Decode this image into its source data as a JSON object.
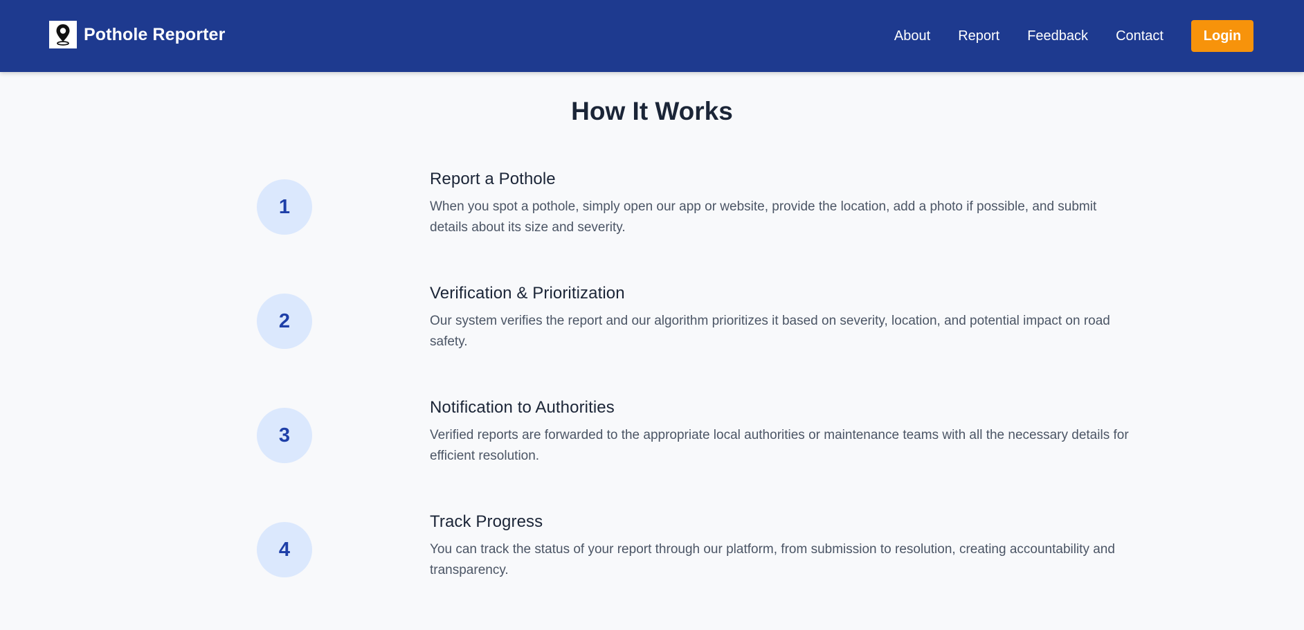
{
  "navbar": {
    "brand": "Pothole Reporter",
    "logo_icon": "map-pin-icon",
    "links": [
      "About",
      "Report",
      "Feedback",
      "Contact"
    ],
    "login_label": "Login"
  },
  "colors": {
    "navbar_bg": "#1e3a8f",
    "accent": "#f7930b",
    "circle_bg": "#dbe8fd",
    "number_color": "#1e3fa8",
    "page_bg": "#f8f9fb"
  },
  "main": {
    "title": "How It Works",
    "steps": [
      {
        "number": "1",
        "title": "Report a Pothole",
        "description": "When you spot a pothole, simply open our app or website, provide the location, add a photo if possible, and submit details about its size and severity."
      },
      {
        "number": "2",
        "title": "Verification & Prioritization",
        "description": "Our system verifies the report and our algorithm prioritizes it based on severity, location, and potential impact on road safety."
      },
      {
        "number": "3",
        "title": "Notification to Authorities",
        "description": "Verified reports are forwarded to the appropriate local authorities or maintenance teams with all the necessary details for efficient resolution."
      },
      {
        "number": "4",
        "title": "Track Progress",
        "description": "You can track the status of your report through our platform, from submission to resolution, creating accountability and transparency."
      }
    ]
  }
}
